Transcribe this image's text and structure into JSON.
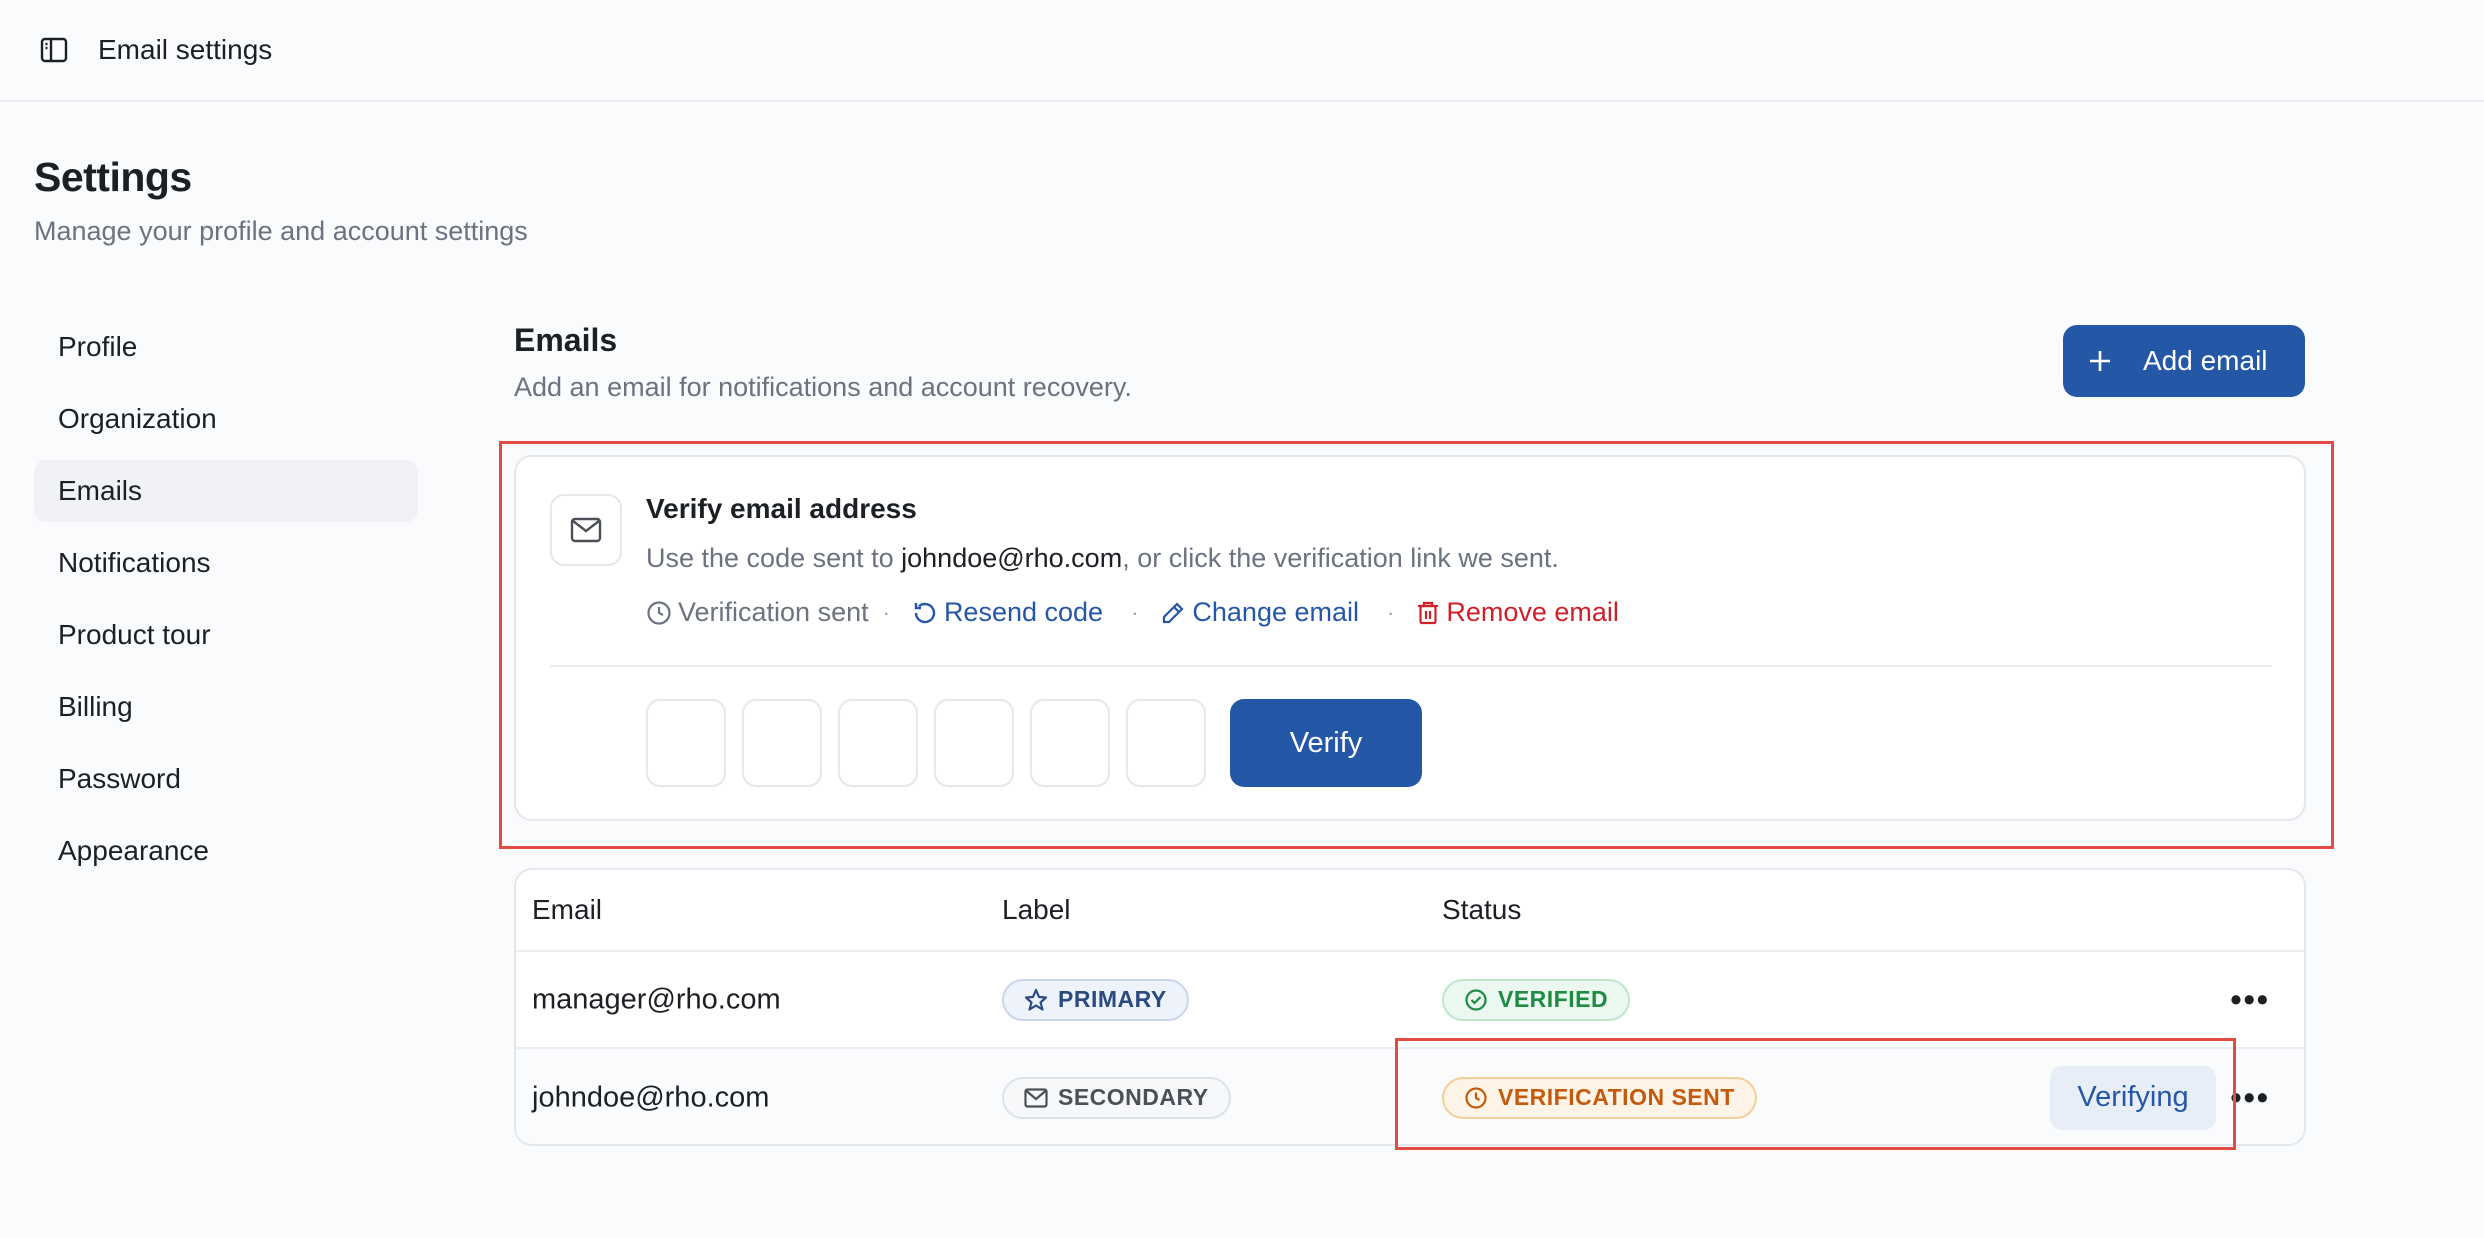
{
  "topbar": {
    "title": "Email settings",
    "toggle_icon": "sidebar-toggle-icon"
  },
  "page": {
    "title": "Settings",
    "subtitle": "Manage your profile and account settings"
  },
  "sidebar": {
    "items": [
      {
        "label": "Profile",
        "active": false
      },
      {
        "label": "Organization",
        "active": false
      },
      {
        "label": "Emails",
        "active": true
      },
      {
        "label": "Notifications",
        "active": false
      },
      {
        "label": "Product tour",
        "active": false
      },
      {
        "label": "Billing",
        "active": false
      },
      {
        "label": "Password",
        "active": false
      },
      {
        "label": "Appearance",
        "active": false
      }
    ]
  },
  "section": {
    "title": "Emails",
    "subtitle": "Add an email for notifications and account recovery.",
    "add_button": "Add email"
  },
  "verify": {
    "title": "Verify email address",
    "desc_prefix": "Use the code sent to ",
    "desc_email": "johndoe@rho.com",
    "desc_suffix": ", or click the verification link we sent.",
    "sent_label": "Verification sent",
    "resend_label": "Resend code",
    "change_label": "Change email",
    "remove_label": "Remove email",
    "code_digits": [
      "",
      "",
      "",
      "",
      "",
      ""
    ],
    "verify_button": "Verify"
  },
  "table": {
    "headers": {
      "email": "Email",
      "label": "Label",
      "status": "Status"
    },
    "rows": [
      {
        "email": "manager@rho.com",
        "label": "PRIMARY",
        "status": "VERIFIED",
        "action": ""
      },
      {
        "email": "johndoe@rho.com",
        "label": "SECONDARY",
        "status": "VERIFICATION SENT",
        "action": "Verifying"
      }
    ]
  },
  "colors": {
    "accent": "#2557a7",
    "danger": "#d0202a",
    "highlight": "#e34a42",
    "verified": "#1e8a44",
    "pending": "#c45a0c"
  }
}
